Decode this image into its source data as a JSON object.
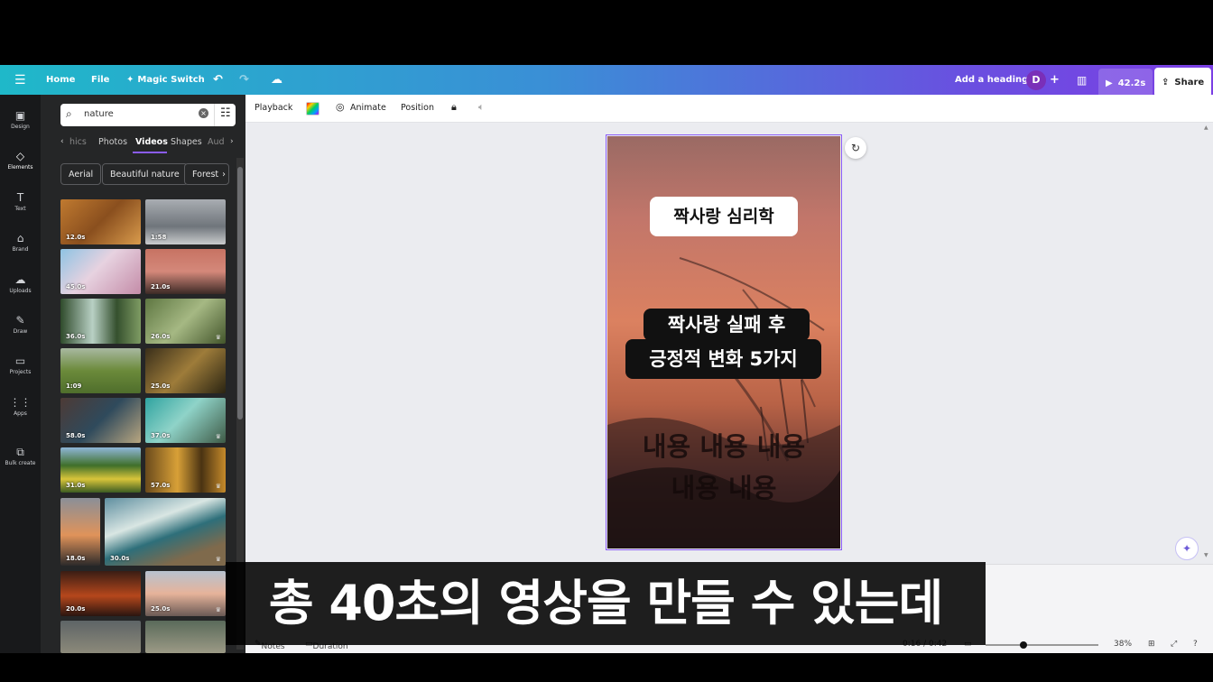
{
  "topbar": {
    "home": "Home",
    "file": "File",
    "magic_switch": "Magic Switch",
    "add_heading": "Add a heading",
    "avatar_initial": "D",
    "play_time": "42.2s",
    "share": "Share",
    "gradient_start": "#1fb8c9",
    "gradient_end": "#7b3fe4"
  },
  "rail": {
    "items": [
      {
        "label": "Design",
        "icon": "design-icon"
      },
      {
        "label": "Elements",
        "icon": "elements-icon"
      },
      {
        "label": "Text",
        "icon": "text-icon"
      },
      {
        "label": "Brand",
        "icon": "brand-icon"
      },
      {
        "label": "Uploads",
        "icon": "upload-icon"
      },
      {
        "label": "Draw",
        "icon": "pen-icon"
      },
      {
        "label": "Projects",
        "icon": "folder-icon"
      },
      {
        "label": "Apps",
        "icon": "apps-icon"
      },
      {
        "label": "Bulk create",
        "icon": "bulk-create-icon"
      }
    ]
  },
  "panel": {
    "search_value": "nature",
    "tabs": [
      "hics",
      "Photos",
      "Videos",
      "Shapes",
      "Aud"
    ],
    "active_tab": "Videos",
    "chips": [
      "Aerial",
      "Beautiful nature",
      "Forest"
    ],
    "thumbs": [
      {
        "duration": "12.0s",
        "premium": false
      },
      {
        "duration": "1:58",
        "premium": false
      },
      {
        "duration": "45.0s",
        "premium": false
      },
      {
        "duration": "21.0s",
        "premium": false
      },
      {
        "duration": "36.0s",
        "premium": false
      },
      {
        "duration": "26.0s",
        "premium": true
      },
      {
        "duration": "1:09",
        "premium": false
      },
      {
        "duration": "25.0s",
        "premium": false
      },
      {
        "duration": "58.0s",
        "premium": false
      },
      {
        "duration": "37.0s",
        "premium": true
      },
      {
        "duration": "31.0s",
        "premium": false
      },
      {
        "duration": "57.0s",
        "premium": true
      },
      {
        "duration": "18.0s",
        "premium": false
      },
      {
        "duration": "30.0s",
        "premium": true
      },
      {
        "duration": "20.0s",
        "premium": false
      },
      {
        "duration": "25.0s",
        "premium": true
      }
    ]
  },
  "toolbar": {
    "playback": "Playback",
    "animate": "Animate",
    "position": "Position"
  },
  "design": {
    "title": "짝사랑 심리학",
    "mid_line1": "짝사랑 실패 후",
    "mid_line2": "긍정적 변화 5가지",
    "body_line1": "내용 내용 내용",
    "body_line2": "내용 내용"
  },
  "footer": {
    "notes": "Notes",
    "duration": "Duration",
    "time": "0:16 / 0:42",
    "zoom": "38%"
  },
  "subtitle": "총 40초의 영상을 만들 수 있는데"
}
